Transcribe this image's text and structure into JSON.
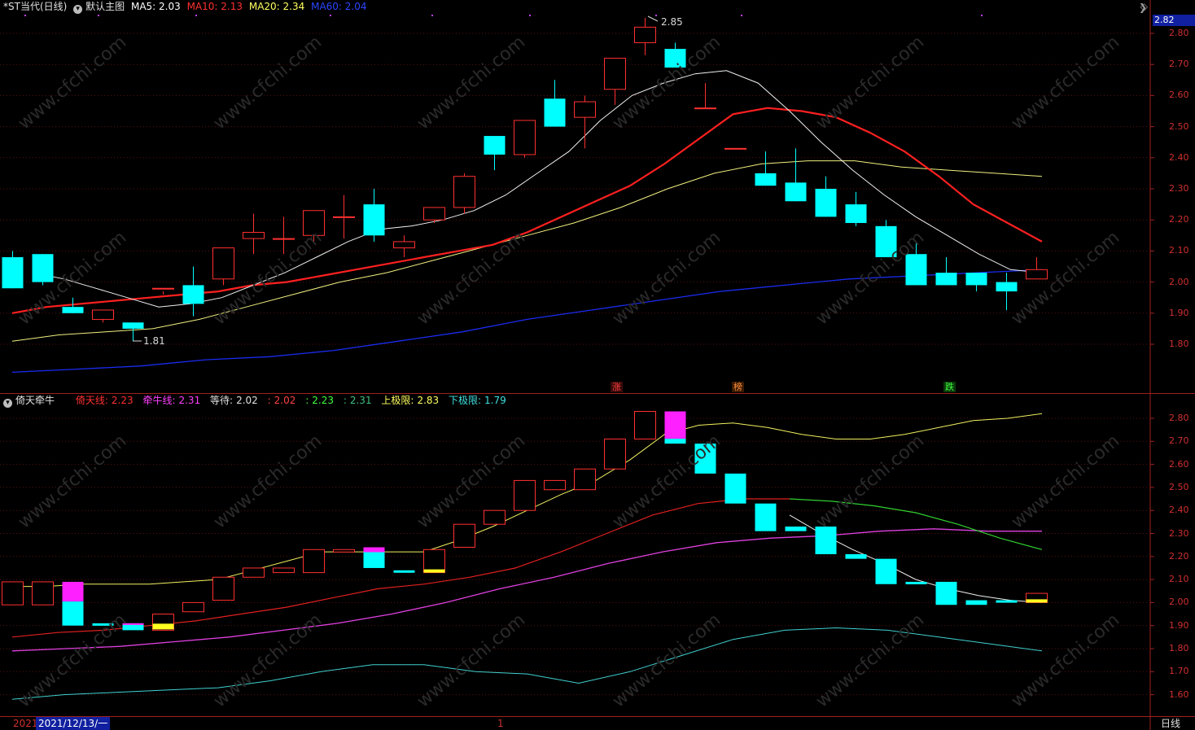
{
  "main": {
    "stock_title": "*ST当代(日线)",
    "template_label": "默认主图",
    "ma": [
      {
        "label": "MA5: 2.03",
        "color": "#ffffff"
      },
      {
        "label": "MA10: 2.13",
        "color": "#ff3030"
      },
      {
        "label": "MA20: 2.34",
        "color": "#ffff60"
      },
      {
        "label": "MA60: 2.04",
        "color": "#2040ff"
      }
    ],
    "high_mark": "2.85",
    "low_mark": "1.81",
    "price_badge": "2.82",
    "tags": [
      {
        "text": "涨",
        "color": "#ff4040"
      },
      {
        "text": "榜",
        "color": "#ff9040"
      },
      {
        "text": "跌",
        "color": "#40ff40"
      }
    ]
  },
  "sub": {
    "indicator_name": "倚天牵牛",
    "values": [
      {
        "label": "倚天线:",
        "value": "2.23",
        "color": "#ff3030"
      },
      {
        "label": "牵牛线:",
        "value": "2.31",
        "color": "#ff40ff"
      },
      {
        "label": "等待:",
        "value": "2.02",
        "color": "#c8c8c8"
      },
      {
        "label": ":",
        "value": "2.02",
        "color": "#ff4040"
      },
      {
        "label": ":",
        "value": "2.23",
        "color": "#40ff40"
      },
      {
        "label": ":",
        "value": "2.31",
        "color": "#40c080"
      },
      {
        "label": "上极限:",
        "value": "2.83",
        "color": "#ffff60"
      },
      {
        "label": "下极限:",
        "value": "1.79",
        "color": "#40e0e0"
      }
    ]
  },
  "bottom": {
    "year": "2021",
    "date": "2021/12/13/一",
    "period": "日线",
    "marker": "1"
  },
  "chart_data": [
    {
      "type": "candlestick",
      "title": "*ST当代(日线)",
      "y_ticks": [
        "2.80",
        "2.70",
        "2.60",
        "2.50",
        "2.40",
        "2.30",
        "2.20",
        "2.10",
        "2.00",
        "1.90",
        "1.80"
      ],
      "ylim": [
        1.7,
        2.9
      ],
      "candles": [
        [
          2.08,
          2.1,
          1.98,
          1.98
        ],
        [
          2.09,
          2.09,
          1.99,
          2.0
        ],
        [
          1.92,
          1.95,
          1.9,
          1.9
        ],
        [
          1.88,
          1.9,
          1.87,
          1.91
        ],
        [
          1.87,
          1.87,
          1.81,
          1.85
        ],
        [
          1.98,
          1.97,
          1.96,
          1.98
        ],
        [
          1.99,
          2.05,
          1.89,
          1.93
        ],
        [
          2.01,
          2.11,
          1.99,
          2.11
        ],
        [
          2.14,
          2.22,
          2.09,
          2.16
        ],
        [
          2.14,
          2.21,
          2.09,
          2.14
        ],
        [
          2.15,
          2.23,
          2.13,
          2.23
        ],
        [
          2.21,
          2.28,
          2.14,
          2.21
        ],
        [
          2.25,
          2.3,
          2.13,
          2.15
        ],
        [
          2.11,
          2.15,
          2.08,
          2.13
        ],
        [
          2.2,
          2.24,
          2.19,
          2.24
        ],
        [
          2.24,
          2.35,
          2.22,
          2.34
        ],
        [
          2.47,
          2.47,
          2.36,
          2.41
        ],
        [
          2.41,
          2.52,
          2.4,
          2.52
        ],
        [
          2.59,
          2.65,
          2.5,
          2.5
        ],
        [
          2.53,
          2.6,
          2.43,
          2.58
        ],
        [
          2.62,
          2.72,
          2.57,
          2.72
        ],
        [
          2.77,
          2.85,
          2.73,
          2.82
        ],
        [
          2.75,
          2.77,
          2.69,
          2.69
        ],
        [
          2.56,
          2.64,
          2.56,
          2.56
        ],
        [
          2.43,
          2.43,
          2.43,
          2.43
        ],
        [
          2.35,
          2.42,
          2.31,
          2.31
        ],
        [
          2.32,
          2.43,
          2.26,
          2.26
        ],
        [
          2.3,
          2.34,
          2.21,
          2.21
        ],
        [
          2.25,
          2.29,
          2.18,
          2.19
        ],
        [
          2.18,
          2.2,
          2.08,
          2.08
        ],
        [
          2.09,
          2.13,
          1.99,
          1.99
        ],
        [
          2.03,
          2.08,
          1.99,
          1.99
        ],
        [
          2.03,
          2.03,
          1.97,
          1.99
        ],
        [
          2.0,
          2.03,
          1.91,
          1.97
        ],
        [
          2.01,
          2.08,
          2.01,
          2.04
        ]
      ],
      "ma5": [
        2.03,
        2.01,
        1.98,
        1.95,
        1.92,
        1.93,
        1.95,
        1.99,
        2.03,
        2.08,
        2.13,
        2.17,
        2.18,
        2.2,
        2.23,
        2.28,
        2.35,
        2.42,
        2.52,
        2.6,
        2.64,
        2.67,
        2.68,
        2.64,
        2.55,
        2.45,
        2.36,
        2.28,
        2.21,
        2.15,
        2.09,
        2.04,
        2.03
      ],
      "ma10": [
        1.9,
        1.92,
        1.93,
        1.94,
        1.95,
        1.96,
        1.97,
        1.99,
        2.0,
        2.02,
        2.04,
        2.06,
        2.08,
        2.1,
        2.12,
        2.16,
        2.21,
        2.26,
        2.31,
        2.38,
        2.46,
        2.54,
        2.56,
        2.55,
        2.53,
        2.48,
        2.42,
        2.34,
        2.25,
        2.19,
        2.13
      ],
      "ma20": [
        1.81,
        1.83,
        1.84,
        1.85,
        1.88,
        1.92,
        1.96,
        2.0,
        2.03,
        2.07,
        2.11,
        2.15,
        2.19,
        2.24,
        2.3,
        2.35,
        2.38,
        2.39,
        2.39,
        2.37,
        2.36,
        2.35,
        2.34
      ],
      "ma60": [
        1.71,
        1.72,
        1.73,
        1.75,
        1.76,
        1.78,
        1.81,
        1.84,
        1.88,
        1.91,
        1.94,
        1.97,
        1.99,
        2.01,
        2.02,
        2.03,
        2.04
      ]
    },
    {
      "type": "indicator",
      "title": "倚天牵牛",
      "y_ticks": [
        "2.80",
        "2.70",
        "2.60",
        "2.50",
        "2.40",
        "2.30",
        "2.20",
        "2.10",
        "2.00",
        "1.90",
        "1.80",
        "1.70",
        "1.60"
      ],
      "ylim": [
        1.55,
        2.9
      ],
      "boxes": [
        {
          "o": 2.09,
          "c": 1.99,
          "k": "up"
        },
        {
          "o": 2.09,
          "c": 1.99,
          "k": "up"
        },
        {
          "o": 2.09,
          "c": 1.9,
          "k": "mix"
        },
        {
          "o": 1.91,
          "c": 1.9,
          "k": "dn"
        },
        {
          "o": 1.91,
          "c": 1.88,
          "k": "mixc"
        },
        {
          "o": 1.95,
          "c": 1.88,
          "k": "ye"
        },
        {
          "o": 2.0,
          "c": 1.96,
          "k": "up"
        },
        {
          "o": 2.11,
          "c": 2.01,
          "k": "up"
        },
        {
          "o": 2.15,
          "c": 2.11,
          "k": "up"
        },
        {
          "o": 2.15,
          "c": 2.13,
          "k": "up"
        },
        {
          "o": 2.23,
          "c": 2.13,
          "k": "up"
        },
        {
          "o": 2.23,
          "c": 2.22,
          "k": "up"
        },
        {
          "o": 2.24,
          "c": 2.15,
          "k": "mixg"
        },
        {
          "o": 2.14,
          "c": 2.13,
          "k": "dn"
        },
        {
          "o": 2.23,
          "c": 2.13,
          "k": "upye"
        },
        {
          "o": 2.34,
          "c": 2.24,
          "k": "up"
        },
        {
          "o": 2.4,
          "c": 2.34,
          "k": "up"
        },
        {
          "o": 2.53,
          "c": 2.4,
          "k": "up"
        },
        {
          "o": 2.53,
          "c": 2.49,
          "k": "up"
        },
        {
          "o": 2.58,
          "c": 2.49,
          "k": "up"
        },
        {
          "o": 2.71,
          "c": 2.58,
          "k": "up"
        },
        {
          "o": 2.83,
          "c": 2.71,
          "k": "up"
        },
        {
          "o": 2.83,
          "c": 2.69,
          "k": "mixt"
        },
        {
          "o": 2.69,
          "c": 2.56,
          "k": "dn"
        },
        {
          "o": 2.56,
          "c": 2.43,
          "k": "dn"
        },
        {
          "o": 2.43,
          "c": 2.31,
          "k": "dn"
        },
        {
          "o": 2.33,
          "c": 2.31,
          "k": "dn"
        },
        {
          "o": 2.33,
          "c": 2.21,
          "k": "dn"
        },
        {
          "o": 2.21,
          "c": 2.19,
          "k": "dn"
        },
        {
          "o": 2.19,
          "c": 2.08,
          "k": "dn"
        },
        {
          "o": 2.09,
          "c": 2.08,
          "k": "dn"
        },
        {
          "o": 2.09,
          "c": 1.99,
          "k": "dn"
        },
        {
          "o": 2.01,
          "c": 1.99,
          "k": "dn"
        },
        {
          "o": 2.01,
          "c": 2.0,
          "k": "dn"
        },
        {
          "o": 2.04,
          "c": 2.0,
          "k": "upye"
        }
      ],
      "upper_limit": [
        2.07,
        2.07,
        2.08,
        2.08,
        2.08,
        2.09,
        2.1,
        2.14,
        2.18,
        2.22,
        2.22,
        2.22,
        2.22,
        2.27,
        2.33,
        2.4,
        2.47,
        2.53,
        2.62,
        2.73,
        2.77,
        2.78,
        2.76,
        2.73,
        2.71,
        2.71,
        2.73,
        2.76,
        2.79,
        2.8,
        2.82
      ],
      "white_line": [
        2.38,
        2.3,
        2.23,
        2.17,
        2.1,
        2.06,
        2.03,
        2.01,
        2.0
      ],
      "green_line": [
        2.45,
        2.44,
        2.42,
        2.39,
        2.34,
        2.28,
        2.23
      ],
      "yitian": [
        1.85,
        1.87,
        1.88,
        1.9,
        1.92,
        1.95,
        1.98,
        2.02,
        2.06,
        2.08,
        2.11,
        2.15,
        2.22,
        2.3,
        2.38,
        2.43,
        2.45,
        2.45
      ],
      "qianniu": [
        1.79,
        1.8,
        1.81,
        1.83,
        1.85,
        1.88,
        1.91,
        1.95,
        2.0,
        2.06,
        2.11,
        2.17,
        2.22,
        2.26,
        2.28,
        2.29,
        2.31,
        2.32,
        2.31,
        2.31
      ],
      "lower_limit": [
        1.58,
        1.6,
        1.61,
        1.62,
        1.63,
        1.66,
        1.7,
        1.73,
        1.73,
        1.7,
        1.69,
        1.65,
        1.7,
        1.77,
        1.84,
        1.88,
        1.89,
        1.88,
        1.85,
        1.82,
        1.79
      ]
    }
  ]
}
